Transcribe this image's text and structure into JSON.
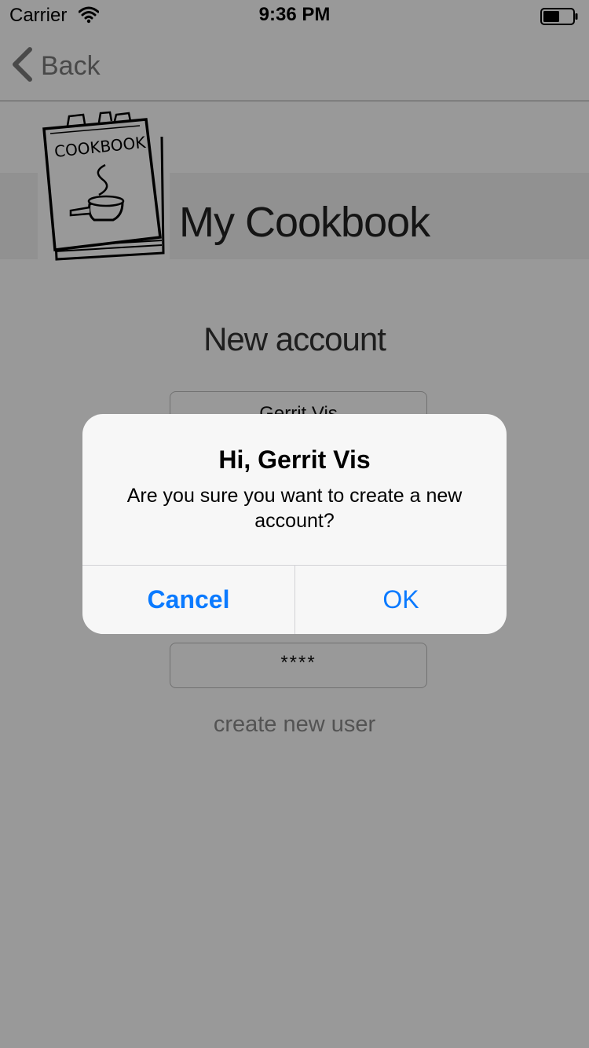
{
  "status_bar": {
    "carrier": "Carrier",
    "time": "9:36 PM",
    "wifi_icon": "wifi-icon",
    "battery_icon": "battery-icon"
  },
  "nav": {
    "back_label": "Back",
    "back_icon": "chevron-left-icon"
  },
  "header": {
    "logo_text": "COOKBOOK",
    "title": "My Cookbook"
  },
  "form": {
    "section_title": "New account",
    "name_value": "Gerrit Vis",
    "password_value": "****",
    "create_link": "create new user"
  },
  "alert": {
    "title": "Hi, Gerrit Vis",
    "message": "Are you sure you want to create a new account?",
    "cancel_label": "Cancel",
    "ok_label": "OK"
  },
  "colors": {
    "accent": "#0a7aff",
    "dim_overlay": "rgba(0,0,0,0.4)",
    "alert_bg": "#f7f7f7"
  }
}
